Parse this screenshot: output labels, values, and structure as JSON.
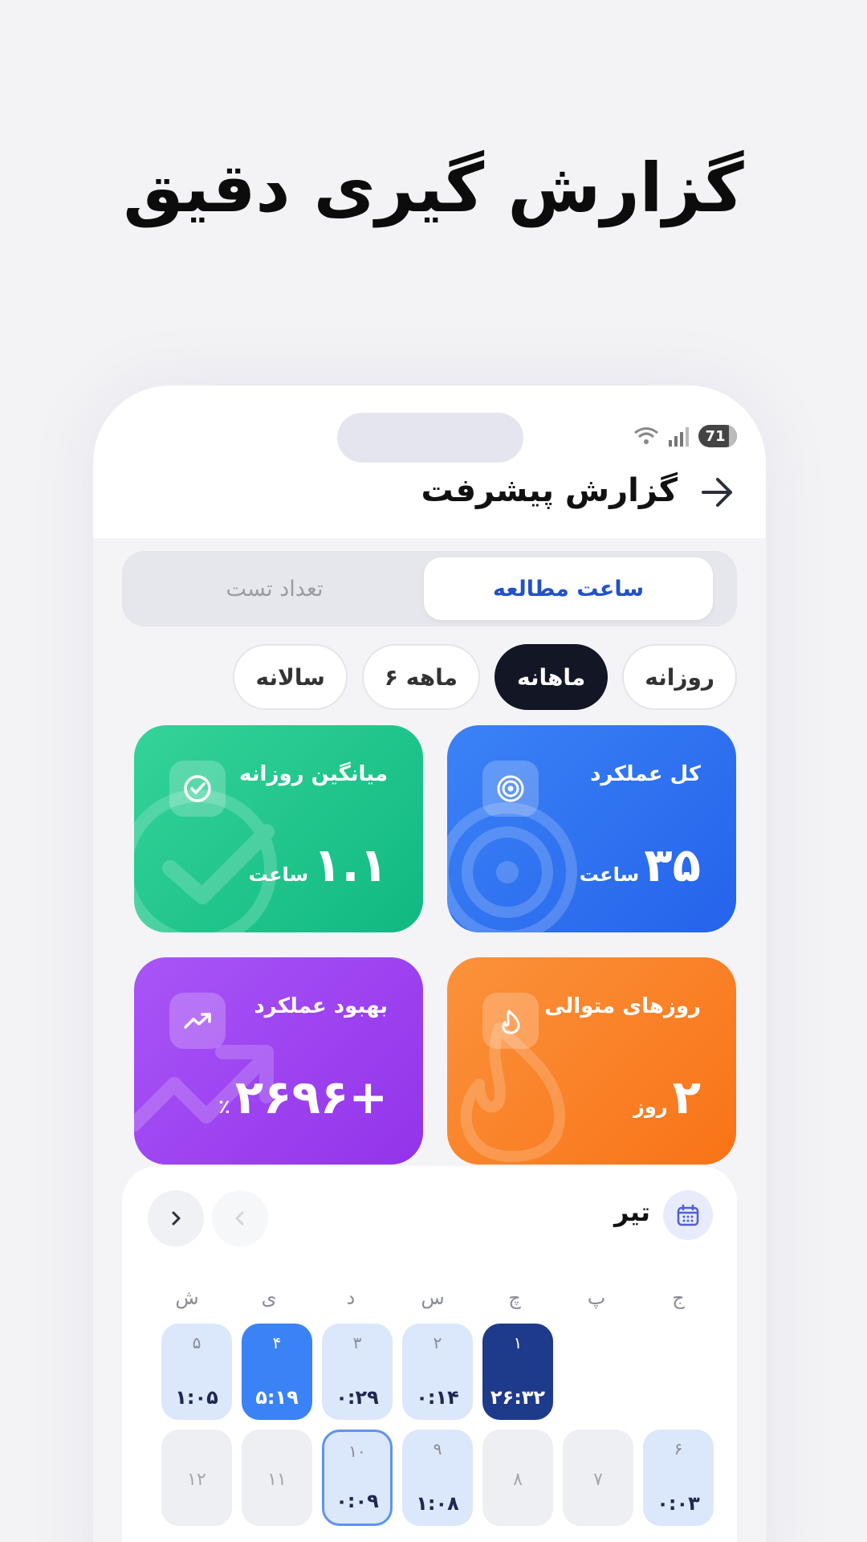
{
  "headline": "گزارش گیری دقیق",
  "status_bar": {
    "battery": "71"
  },
  "header": {
    "title": "گزارش پیشرفت"
  },
  "segments": {
    "active": "ساعت مطالعه",
    "inactive": "تعداد تست"
  },
  "periods": [
    {
      "label": "روزانه",
      "active": false
    },
    {
      "label": "ماهانه",
      "active": true
    },
    {
      "label": "۶ ماهه",
      "active": false
    },
    {
      "label": "سالانه",
      "active": false
    }
  ],
  "cards": {
    "total": {
      "title": "کل عملکرد",
      "value": "۳۵",
      "unit": "ساعت",
      "icon": "target-icon"
    },
    "average": {
      "title": "میانگین روزانه",
      "value": "۱.۱",
      "unit": "ساعت",
      "icon": "check-circle-icon"
    },
    "streak": {
      "title": "روزهای متوالی",
      "value": "۲",
      "unit": "روز",
      "icon": "flame-icon"
    },
    "improvement": {
      "title": "بهبود عملکرد",
      "value": "+۲۶۹۶",
      "unit": "٪",
      "icon": "trending-up-icon"
    }
  },
  "calendar": {
    "month": "تیر",
    "weekdays": [
      "ش",
      "ی",
      "د",
      "س",
      "چ",
      "پ",
      "ج"
    ],
    "days": [
      {
        "num": "",
        "time": "",
        "style": "empty"
      },
      {
        "num": "",
        "time": "",
        "style": "empty"
      },
      {
        "num": "۱",
        "time": "۲۶:۳۲",
        "style": "navy"
      },
      {
        "num": "۲",
        "time": "۰:۱۴",
        "style": "light"
      },
      {
        "num": "۳",
        "time": "۰:۲۹",
        "style": "light"
      },
      {
        "num": "۴",
        "time": "۵:۱۹",
        "style": "blue"
      },
      {
        "num": "۵",
        "time": "۱:۰۵",
        "style": "light"
      },
      {
        "num": "۶",
        "time": "۰:۰۳",
        "style": "light"
      },
      {
        "num": "۷",
        "time": "",
        "style": "gray"
      },
      {
        "num": "۸",
        "time": "",
        "style": "gray"
      },
      {
        "num": "۹",
        "time": "۱:۰۸",
        "style": "light"
      },
      {
        "num": "۱۰",
        "time": "۰:۰۹",
        "style": "selected"
      },
      {
        "num": "۱۱",
        "time": "",
        "style": "gray"
      },
      {
        "num": "۱۲",
        "time": "",
        "style": "gray"
      }
    ]
  },
  "colors": {
    "accent": "#2251c9",
    "dark_pill": "#121625",
    "green": "#10b981",
    "blue": "#2563eb",
    "purple": "#9333ea",
    "orange": "#f97316"
  }
}
